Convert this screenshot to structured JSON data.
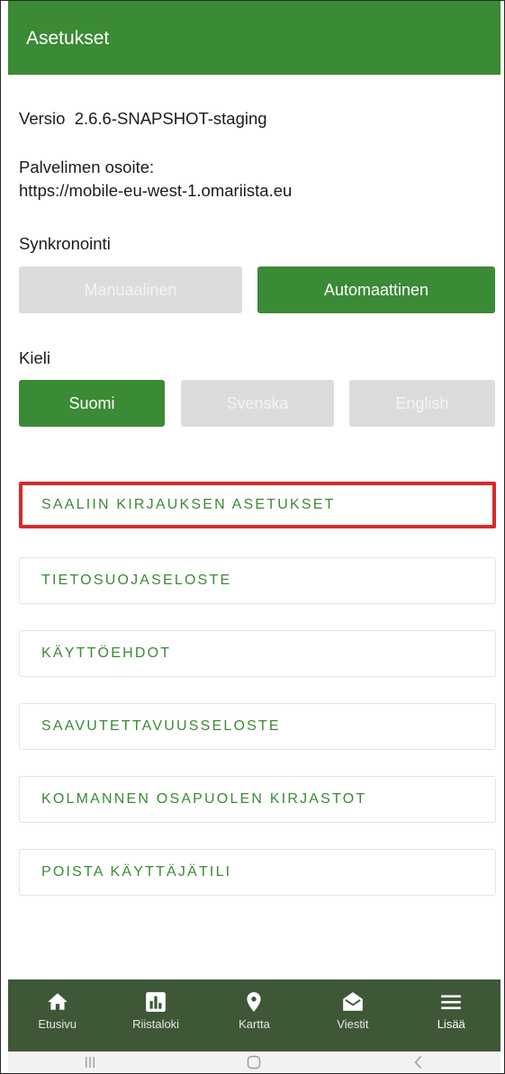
{
  "appbar": {
    "title": "Asetukset"
  },
  "settings": {
    "version_text": "Versio  2.6.6-SNAPSHOT-staging",
    "server_label": "Palvelimen osoite:",
    "server_value": "https://mobile-eu-west-1.omariista.eu",
    "sync": {
      "title": "Synkronointi",
      "options": [
        "Manuaalinen",
        "Automaattinen"
      ],
      "selected": "Automaattinen"
    },
    "language": {
      "title": "Kieli",
      "options": [
        "Suomi",
        "Svenska",
        "English"
      ],
      "selected": "Suomi"
    }
  },
  "menu": {
    "items": [
      "SAALIIN KIRJAUKSEN ASETUKSET",
      "TIETOSUOJASELOSTE",
      "KÄYTTÖEHDOT",
      "SAAVUTETTAVUUSSELOSTE",
      "KOLMANNEN OSAPUOLEN KIRJASTOT",
      "POISTA KÄYTTÄJÄTILI"
    ],
    "highlighted_index": 0
  },
  "bottom_nav": {
    "items": [
      {
        "label": "Etusivu",
        "icon": "home-icon"
      },
      {
        "label": "Riistaloki",
        "icon": "bar-chart-icon"
      },
      {
        "label": "Kartta",
        "icon": "map-pin-icon"
      },
      {
        "label": "Viestit",
        "icon": "mail-icon"
      },
      {
        "label": "Lisää",
        "icon": "menu-icon"
      }
    ]
  },
  "system_nav": {
    "icons": [
      "recents-icon",
      "home-circle-icon",
      "back-icon"
    ]
  },
  "colors": {
    "primary": "#3b8a35",
    "nav_bg": "#3e5837",
    "disabled": "#dcdcdc",
    "highlight": "#d82a2a"
  }
}
